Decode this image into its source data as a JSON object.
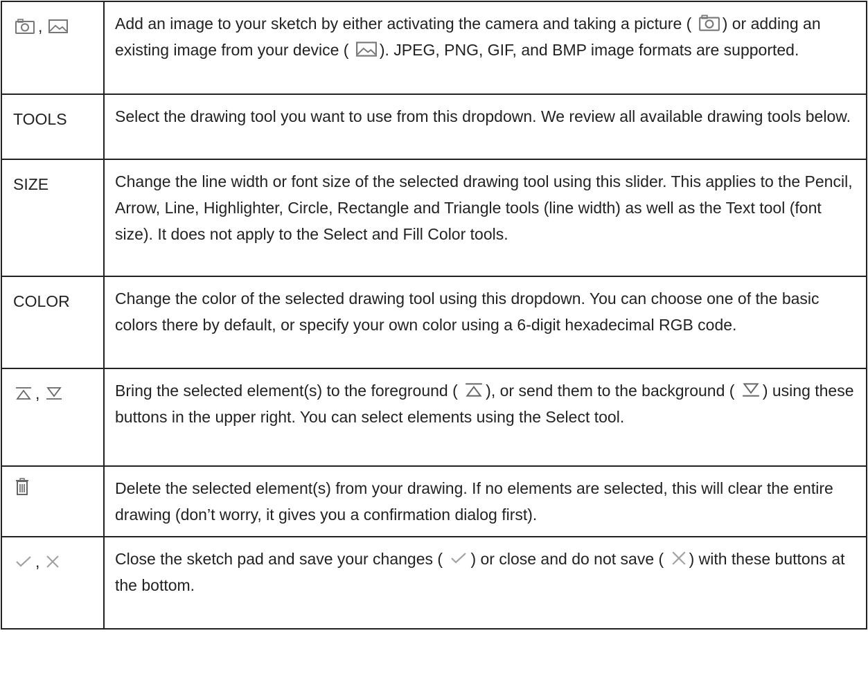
{
  "rows": [
    {
      "key_sep": ",",
      "parts": [
        {
          "t": "Add an image to your sketch by either activating the camera and taking a picture ("
        },
        {
          "t": ") or adding an existing image from your device ("
        },
        {
          "t": "). JPEG, PNG, GIF, and BMP image formats are supported."
        }
      ]
    },
    {
      "key": "TOOLS",
      "text": "Select the drawing tool you want to use from this dropdown. We review all available drawing tools below."
    },
    {
      "key": "SIZE",
      "text": "Change the line width or font size of the selected drawing tool using this slider. This applies to the Pencil, Arrow, Line, Highlighter, Circle, Rectangle and Triangle tools (line width) as well as the Text tool (font size). It does not apply to the Select and Fill Color tools."
    },
    {
      "key": "COLOR",
      "text": "Change the color of the selected drawing tool using this dropdown. You can choose one of the basic colors there by default, or specify your own color using a 6-digit hexadecimal RGB code."
    },
    {
      "key_sep": ",",
      "parts": [
        {
          "t": "Bring the selected element(s) to the foreground ("
        },
        {
          "t": "), or send them to the background ("
        },
        {
          "t": ") using these buttons in the upper right. You can select elements using the Select tool."
        }
      ]
    },
    {
      "text": "Delete the selected element(s) from your drawing. If no elements are selected, this will clear the entire drawing (don’t worry, it gives you a confirmation dialog first)."
    },
    {
      "key_sep": ",",
      "parts": [
        {
          "t": "Close the sketch pad and save your changes ("
        },
        {
          "t": ") or close and do not save ("
        },
        {
          "t": ") with these buttons at the bottom."
        }
      ]
    }
  ],
  "icons": {
    "camera": "camera-icon",
    "image": "image-icon",
    "bring_front": "bring-to-front-icon",
    "send_back": "send-to-back-icon",
    "trash": "trash-icon",
    "check": "check-icon",
    "close": "close-icon"
  },
  "colors": {
    "text": "#222222",
    "border": "#222222",
    "icon": "#666666",
    "icon_light": "#9a9a9a"
  }
}
